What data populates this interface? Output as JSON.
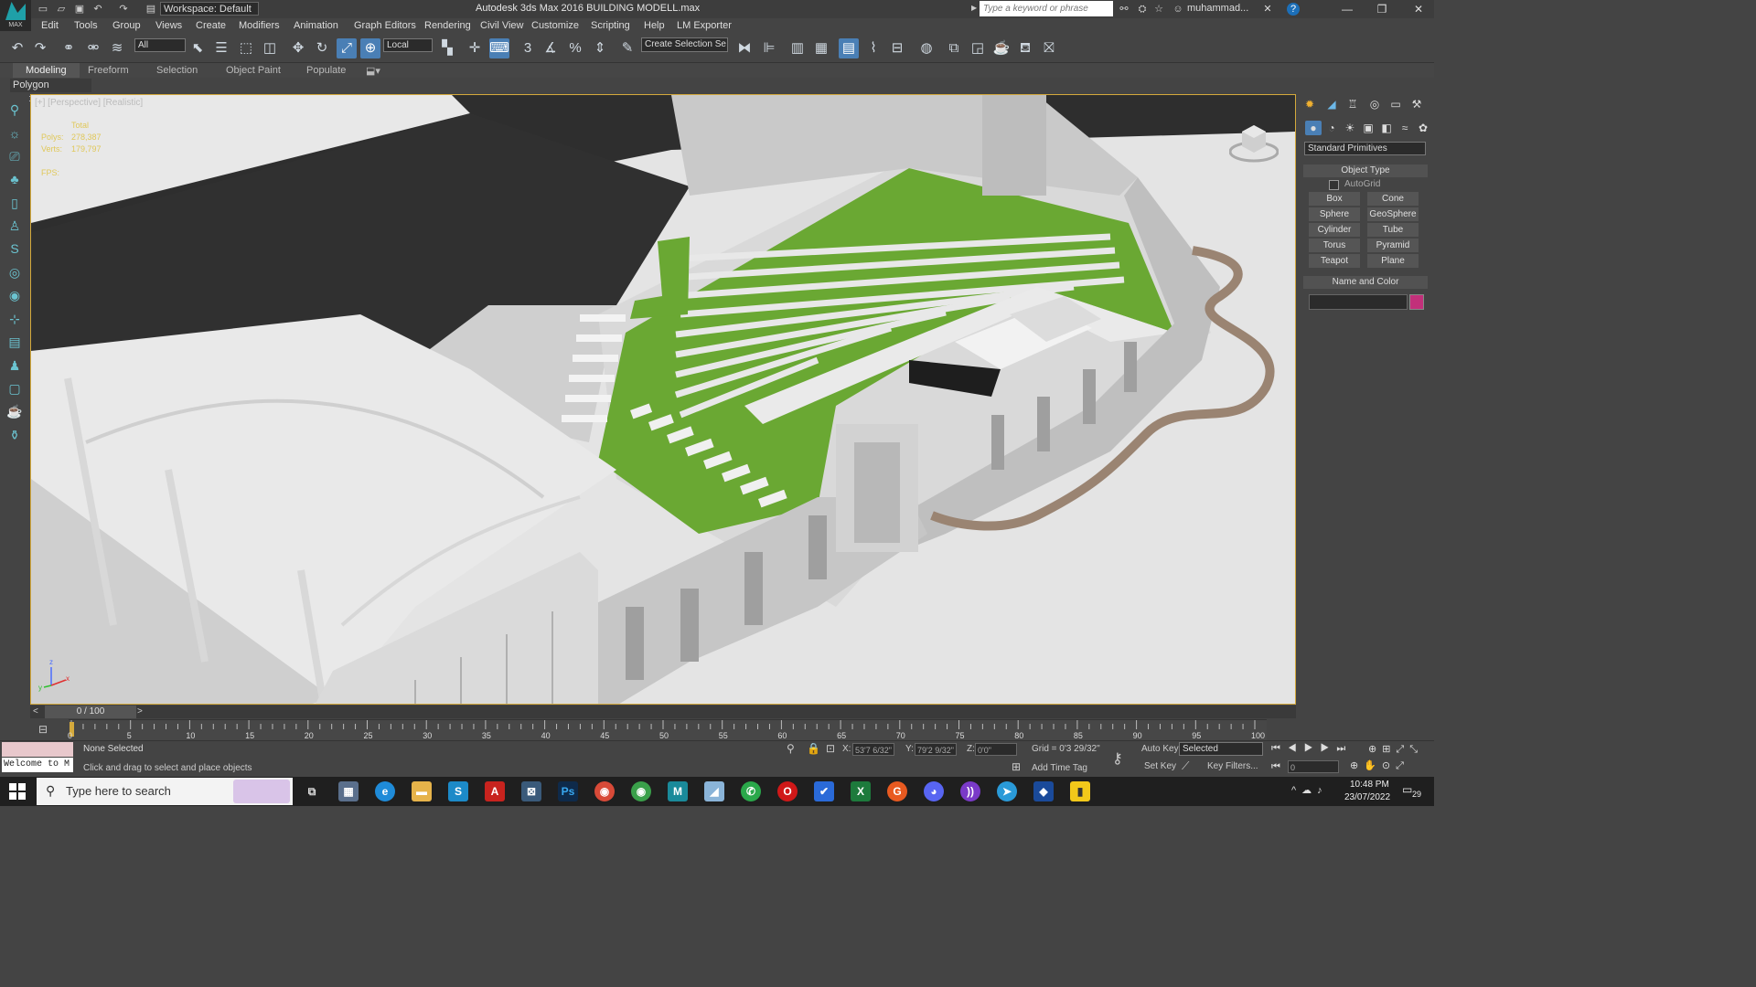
{
  "app": {
    "logo_caption": "MAX",
    "workspace": "Workspace: Default",
    "title": "Autodesk 3ds Max 2016    BUILDING MODELL.max",
    "search_placeholder": "Type a keyword or phrase",
    "user": "muhammad...",
    "help": "?"
  },
  "menu": [
    "Edit",
    "Tools",
    "Group",
    "Views",
    "Create",
    "Modifiers",
    "Animation",
    "Graph Editors",
    "Rendering",
    "Civil View",
    "Customize",
    "Scripting",
    "Help",
    "LM Exporter"
  ],
  "toolbar": {
    "selection_filter": "All",
    "reference_coord": "Local",
    "named_selection": "Create Selection Se",
    "snap_3": "3",
    "angle_snap_pct": "%"
  },
  "ribbon": {
    "tabs": [
      "Modeling",
      "Freeform",
      "Selection",
      "Object Paint",
      "Populate"
    ],
    "active": "Modeling",
    "panel_label": "Polygon Modeling"
  },
  "viewport": {
    "label": "[+] [Perspective] [Realistic]",
    "stats": {
      "total": "Total",
      "polys_label": "Polys:",
      "polys": "278,387",
      "verts_label": "Verts:",
      "verts": "179,797",
      "fps_label": "FPS:"
    },
    "axis": {
      "x": "x",
      "y": "y",
      "z": "z"
    }
  },
  "command_panel": {
    "category": "Standard Primitives",
    "object_type_title": "Object Type",
    "autogrid": "AutoGrid",
    "buttons": [
      "Box",
      "Cone",
      "Sphere",
      "GeoSphere",
      "Cylinder",
      "Tube",
      "Torus",
      "Pyramid",
      "Teapot",
      "Plane"
    ],
    "name_color_title": "Name and Color",
    "object_color": "#c2307a"
  },
  "timeline": {
    "frame": "0 / 100",
    "ticks": [
      "0",
      "5",
      "10",
      "15",
      "20",
      "25",
      "30",
      "35",
      "40",
      "45",
      "50",
      "55",
      "60",
      "65",
      "70",
      "75",
      "80",
      "85",
      "90",
      "95",
      "100"
    ]
  },
  "status": {
    "maxscript": "Welcome to M",
    "selection": "None Selected",
    "prompt": "Click and drag to select and place objects",
    "x_label": "X:",
    "x": "53'7 6/32\"",
    "y_label": "Y:",
    "y": "79'2 9/32\"",
    "z_label": "Z:",
    "z": "0'0\"",
    "grid": "Grid = 0'3 29/32\"",
    "add_time_tag": "Add Time Tag",
    "auto_key": "Auto Key",
    "auto_key_mode": "Selected",
    "set_key": "Set Key",
    "key_filters": "Key Filters...",
    "current_frame": "0"
  },
  "taskbar": {
    "search": "Type here to search",
    "time": "10:48 PM",
    "date": "23/07/2022",
    "notifications": "29"
  },
  "colors": {
    "accent": "#d4a93c",
    "grass": "#6aa833",
    "active_blue": "#4a7fb5"
  }
}
